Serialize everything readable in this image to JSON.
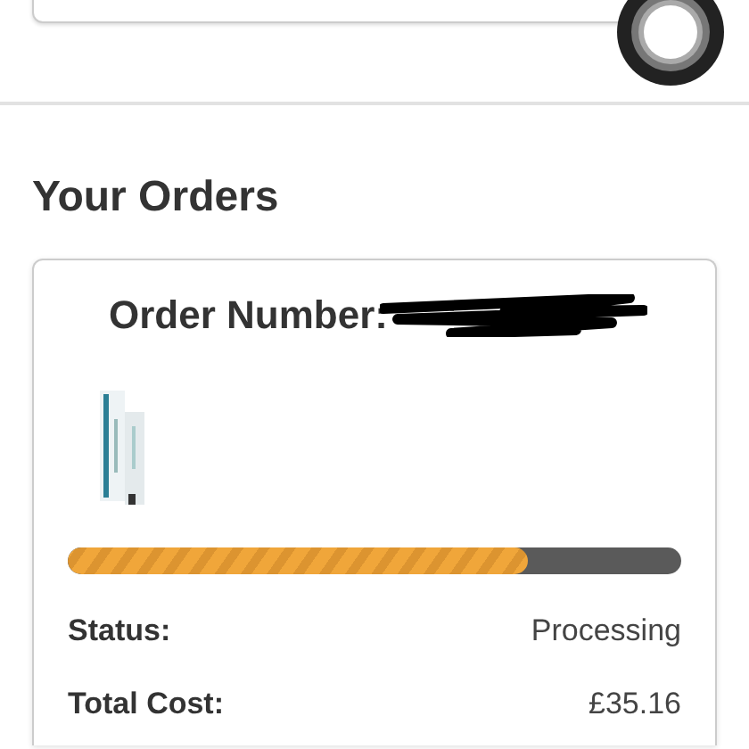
{
  "heading": "Your Orders",
  "order": {
    "number_label": "Order Number:",
    "number_redacted": true,
    "progress": {
      "level": 0.75
    },
    "details": [
      {
        "label": "Status:",
        "value": "Processing"
      },
      {
        "label": "Total Cost:",
        "value": "£35.16"
      }
    ]
  }
}
